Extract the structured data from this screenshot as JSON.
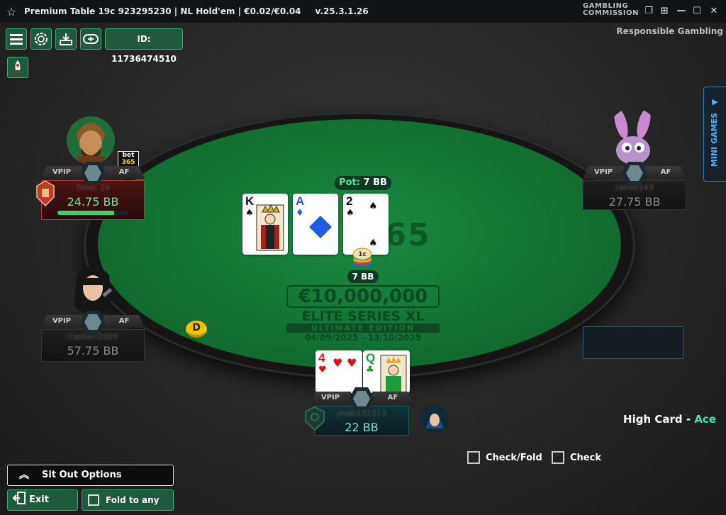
{
  "titlebar": {
    "title": "Premium Table 19c 923295230 | NL Hold'em | €0.02/€0.04",
    "version": "v.25.3.1.26",
    "gc_line1": "GAMBLING",
    "gc_line2": "COMMISSION"
  },
  "toolbar": {
    "player_id": "ID: 11736474510",
    "responsible": "Responsible Gambling"
  },
  "mini_games": {
    "label": "MINI GAMES"
  },
  "table": {
    "pot_label": "Pot:",
    "pot_value": "7 BB",
    "chip_amount": "7 BB",
    "chip_denom": "1c",
    "watermark": "365",
    "promo": {
      "amount": "€10,000,000",
      "series": "ELITE SERIES XL",
      "edition": "ULTIMATE EDITION",
      "dates": "04/09/2025 - 13/10/2025"
    },
    "dealer_button": "D"
  },
  "board": [
    {
      "rank": "K",
      "suit": "♠",
      "color": "black"
    },
    {
      "rank": "A",
      "suit": "♦",
      "color": "blue"
    },
    {
      "rank": "2",
      "suit": "♠",
      "color": "black"
    }
  ],
  "hero_cards": [
    {
      "rank": "4",
      "suit": "♥",
      "color": "red"
    },
    {
      "rank": "Q",
      "suit": "♣",
      "color": "green"
    }
  ],
  "seats": {
    "top_left": {
      "vpip": "VPIP",
      "af": "AF",
      "name": "Time: 19",
      "stack": "24.75 BB",
      "timer_fraction": 0.8
    },
    "mid_left": {
      "vpip": "VPIP",
      "af": "AF",
      "name": "Captain2020",
      "stack": "57.75 BB"
    },
    "top_right": {
      "vpip": "VPIP",
      "af": "AF",
      "name": "rabbit143",
      "stack": "27.75 BB"
    },
    "hero": {
      "vpip": "VPIP",
      "af": "AF",
      "name": "jmab131313",
      "stack": "22 BB"
    }
  },
  "badge": {
    "line1": "bet",
    "line2": "365"
  },
  "hand_rank": {
    "prefix": "High Card - ",
    "value": "Ace"
  },
  "actions": {
    "check_fold": "Check/Fold",
    "check": "Check",
    "sit_out": "Sit Out Options",
    "exit": "Exit",
    "fold_any": "Fold to any bet"
  },
  "colors": {
    "accent": "#3fae78",
    "felt": "#147435",
    "active_seat": "#c03030"
  }
}
